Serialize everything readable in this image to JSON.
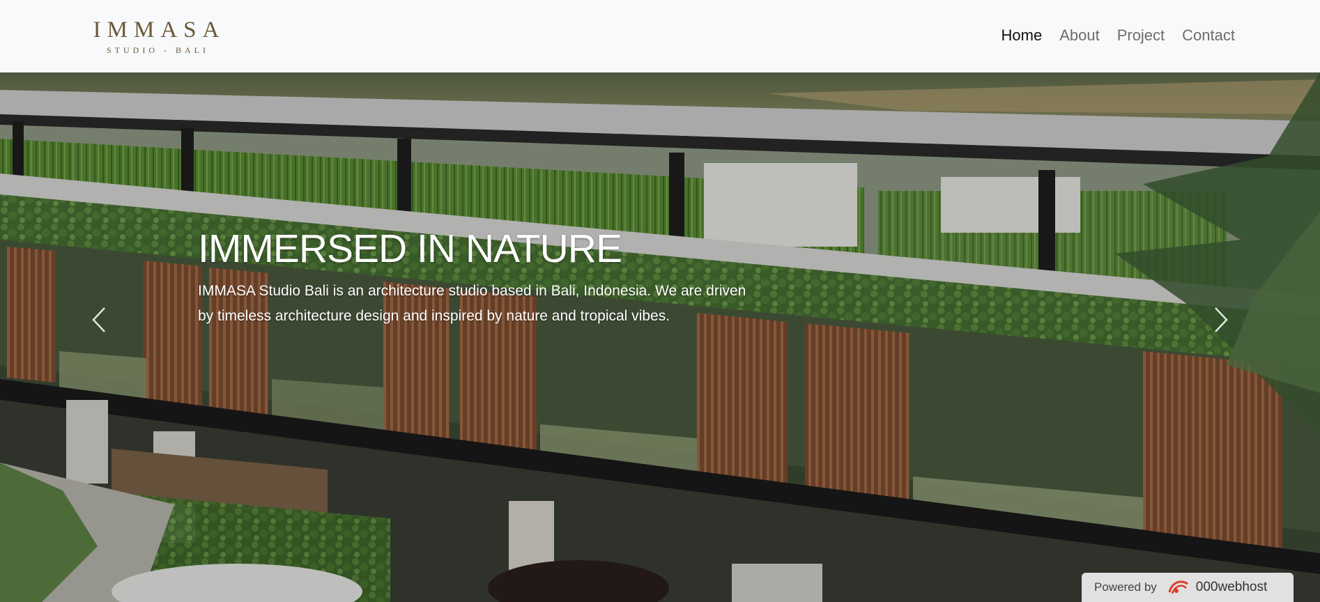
{
  "brand": {
    "name": "IMMASA",
    "tagline": "STUDIO - BALI"
  },
  "nav": {
    "items": [
      {
        "label": "Home",
        "active": true
      },
      {
        "label": "About",
        "active": false
      },
      {
        "label": "Project",
        "active": false
      },
      {
        "label": "Contact",
        "active": false
      }
    ]
  },
  "hero": {
    "title": "IMMERSED IN NATURE",
    "description": "IMMASA Studio Bali is an architecture studio based in Bali, Indonesia. We are driven by timeless architecture design and inspired by nature and tropical vibes.",
    "prev_icon": "chevron-left-icon",
    "next_icon": "chevron-right-icon"
  },
  "footer_badge": {
    "powered": "Powered by",
    "brand": "000webhost",
    "icon": "000webhost-logo-icon"
  },
  "colors": {
    "logo": "#6b5838",
    "nav_active": "#111111",
    "nav_inactive": "#6c6c6c",
    "header_bg": "#f8f9fa"
  }
}
